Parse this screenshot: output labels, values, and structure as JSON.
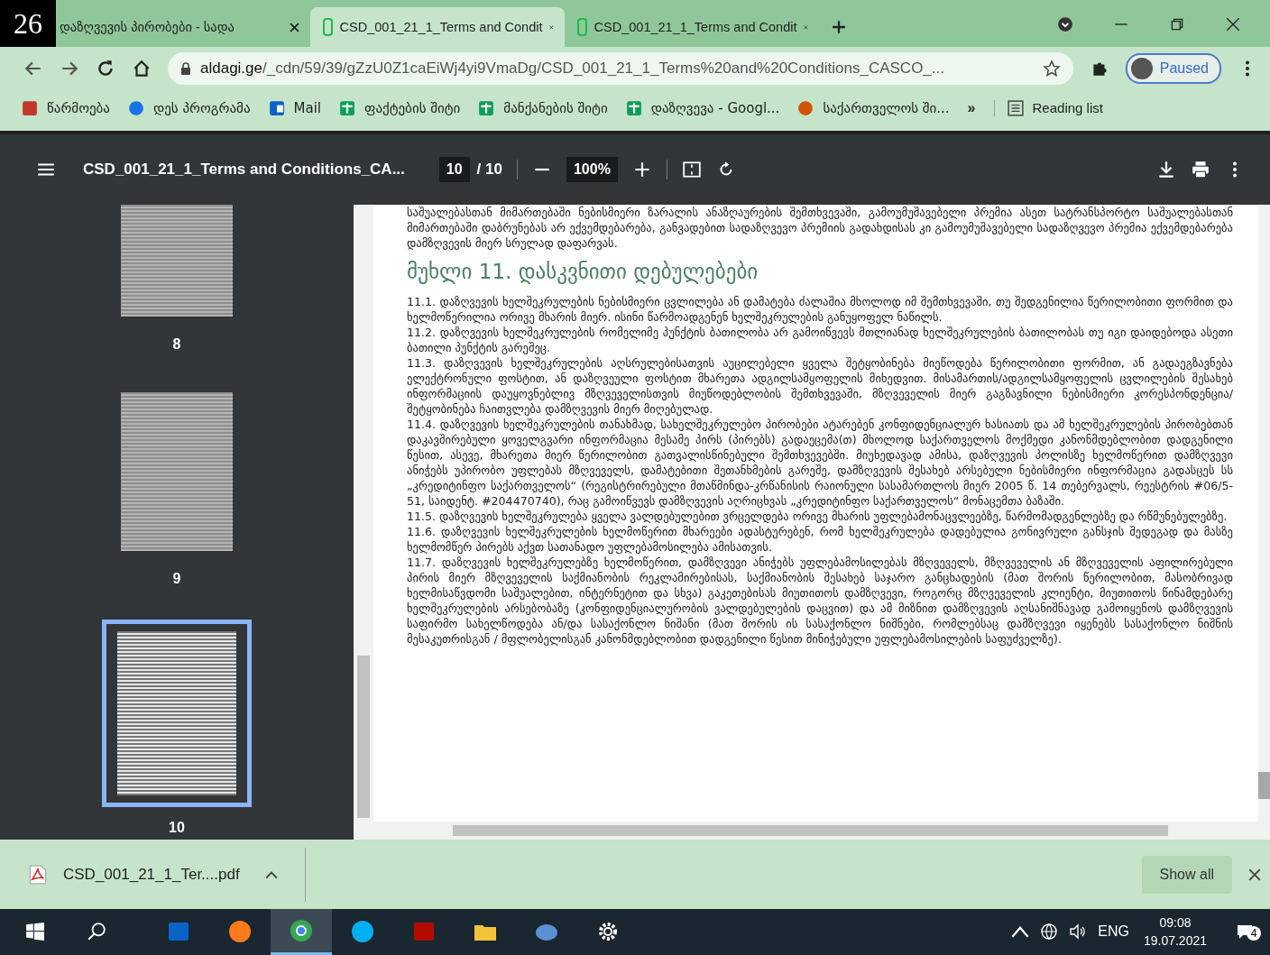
{
  "badge": "26",
  "tabs": [
    {
      "title": "დაზღვევის პირობები - სადა",
      "selected": false,
      "kind": "site"
    },
    {
      "title": "CSD_001_21_1_Terms and Condit",
      "selected": true,
      "kind": "doc"
    },
    {
      "title": "CSD_001_21_1_Terms and Condit",
      "selected": false,
      "kind": "doc"
    }
  ],
  "address": {
    "url_host": "aldagi.ge",
    "url_path": "/_cdn/59/39/gZzU0Z1caEiWj4yi9VmaDg/CSD_001_21_1_Terms%20and%20Conditions_CASCO_..."
  },
  "profile": {
    "label": "Paused"
  },
  "bookmarks": [
    {
      "label": "წარმოება",
      "kind": "app"
    },
    {
      "label": "დეს პროგრამა",
      "kind": "globe"
    },
    {
      "label": "Mail",
      "kind": "mail"
    },
    {
      "label": "ფაქტების შიტი",
      "kind": "sheet"
    },
    {
      "label": "მანქანების შიტი",
      "kind": "sheet"
    },
    {
      "label": "დაზღვევა - Googl...",
      "kind": "sheet"
    },
    {
      "label": "საქართველოს ში...",
      "kind": "emblem"
    }
  ],
  "bookmarks_more": "»",
  "reading_list": "Reading list",
  "pdf_toolbar": {
    "title": "CSD_001_21_1_Terms and Conditions_CA...",
    "page": "10",
    "page_total": "/ 10",
    "zoom": "100%"
  },
  "thumbnails": [
    {
      "label": "8",
      "selected": false
    },
    {
      "label": "9",
      "selected": false
    },
    {
      "label": "10",
      "selected": true
    }
  ],
  "document": {
    "paragraphs": [
      {
        "kind": "text",
        "text": "საშუალებასთან მიმართებაში ნებისმიერი ზარალის ანაზღაურების შემთხვევაში, გამოუმუშავებელი პრემია ასეთ სატრანსპორტო საშუალებასთან მიმართებაში დაბრუნებას არ ექვემდებარება, განვადებით სადაზღვევო პრემიის გადახდისას კი გამოუმუშავებელი სადაზღვევო პრემია ექვემდებარება დამზღვევის მიერ სრულად დაფარვას."
      },
      {
        "kind": "heading",
        "text": "მუხლი 11. დასკვნითი დებულებები"
      },
      {
        "kind": "text",
        "text": "11.1. დაზღვევის ხელშეკრულების ნებისმიერი ცვლილება ან დამატება ძალაშია მხოლოდ იმ შემთხვევაში, თუ შედგენილია წერილობითი ფორმით და ხელმოწერილია ორივე მხარის მიერ. ისინი წარმოადგენენ ხელშეკრულების განუყოფელ ნაწილს."
      },
      {
        "kind": "text",
        "text": "11.2. დაზღვევის ხელშეკრულების რომელიმე პუნქტის ბათილობა არ გამოიწვევს მთლიანად ხელშეკრულების ბათილობას თუ იგი დაიდებოდა ასეთი ბათილი პუნქტის გარეშეც."
      },
      {
        "kind": "text",
        "text": "11.3. დაზღვევის ხელშეკრულების აღსრულებისათვის აუცილებელი ყველა შეტყობინება მიეწოდება წერილობითი ფორმით, ან გადაეგზავნება ელექტრონული ფოსტით, ან დაზღვეული ფოსტით მხარეთა ადგილსამყოფელის მიხედვით. მისამართის/ადგილსამყოფელის ცვლილების შესახებ ინფორმაციის დაუყოვნებლივ მზღვეველისთვის მიუწოდებლობის შემთხვევაში, მზღვეველის მიერ გაგზავნილი ნებისმიერი კორესპონდენცია/შეტყობინება ჩაითვლება დამზღვევის მიერ მიღებულად."
      },
      {
        "kind": "text",
        "text": "11.4. დაზღვევის ხელშეკრულების თანახმად, სახელშეკრულებო პირობები ატარებენ კონფიდენციალურ ხასიათს და ამ ხელშეკრულების პირობებთან დაკავშირებული ყოველგვარი ინფორმაცია მესამე პირს (პირებს) გადაეცემა(თ) მხოლოდ საქართველოს მოქმედი კანონმდებლობით დადგენილი წესით, ასევე, მხარეთა მიერ წერილობით გათვალისწინებული შემთხვევებში. მიუხედავად ამისა, დაზღვევის პოლისზე ხელმოწერით დამზღვევი ანიჭებს უპირობო უფლებას მზღვეველს, დამატებითი შეთანხმების გარეშე, დამზღვევის შესახებ არსებული ნებისმიერი ინფორმაცია გადასცეს სს „კრედიტინფო საქართველოს“ (რეგისტრირებული მთაწმინდა-კრწანისის რაიონული სასამართლოს მიერ 2005 წ. 14 თებერვალს, რეესტრის #06/5-51, საიდენტ. #204470740), რაც გამოიწვევს დამზღვევის აღრიცხვას „კრედიტინფო საქართველოს“ მონაცემთა ბაზაში."
      },
      {
        "kind": "text",
        "text": "11.5. დაზღვევის ხელშეკრულება ყველა ვალდებულებით ვრცელდება ორივე მხარის უფლებამონაცვლეებზე, წარმომადგენლებზე და რწმუნებულებზე."
      },
      {
        "kind": "text",
        "text": "11.6. დაზღვევის ხელშეკრულების ხელმოწერით მხარეები ადასტურებენ, რომ ხელშეკრულება დადებულია გონივრული განსჯის შედეგად და მასზე ხელმომწერ პირებს აქვთ სათანადო უფლებამოსილება ამისათვის."
      },
      {
        "kind": "text",
        "text": "11.7. დაზღვევის ხელშეკრულებზე ხელმოწერით, დამზღვევი ანიჭებს უფლებამოსილებას მზღვეველს, მზღვეველის ან მზღვეველის აფილირებული პირის მიერ მზღვეველის საქმიანობის რეკლამირებისას, საქმიანობის შესახებ საჯარო განცხადების (მათ შორის წერილობით, მასობრივად ხელმისაწვდომი საშუალებით, ინტერნეტით და სხვა) გაკეთებისას მიუთითოს დამზღვევი, როგორც მზღვეველის კლიენტი, მიუთითოს წინამდებარე ხელშეკრულების არსებობაზე (კონფიდენციალურობის ვალდებულების დაცვით) და ამ მიზნით დამზღვევის აღსანიშნავად გამოიყენოს დამზღვევის საფირმო სახელწოდება ან/და სასაქონლო ნიშანი (მათ შორის ის სასაქონლო ნიშნები, რომლებსაც დამზღვევი იყენებს სასაქონლო ნიშნის მესაკუთრისგან / მფლობელისგან კანონმდებლობით დადგენილი წესით მინიჭებული უფლებამოსილების საფუძველზე)."
      }
    ]
  },
  "download": {
    "file": "CSD_001_21_1_Ter....pdf",
    "show_all": "Show all"
  },
  "taskbar": {
    "apps": [
      {
        "kind": "outlook",
        "selected": false
      },
      {
        "kind": "firefox",
        "selected": false
      },
      {
        "kind": "chrome",
        "selected": true
      },
      {
        "kind": "skype",
        "selected": false
      },
      {
        "kind": "acrobat",
        "selected": false
      },
      {
        "kind": "folder",
        "selected": false
      },
      {
        "kind": "paint",
        "selected": false
      },
      {
        "kind": "settings",
        "selected": false
      }
    ],
    "language": "ENG",
    "time": "09:08",
    "date": "19.07.2021",
    "notifications": "4"
  }
}
